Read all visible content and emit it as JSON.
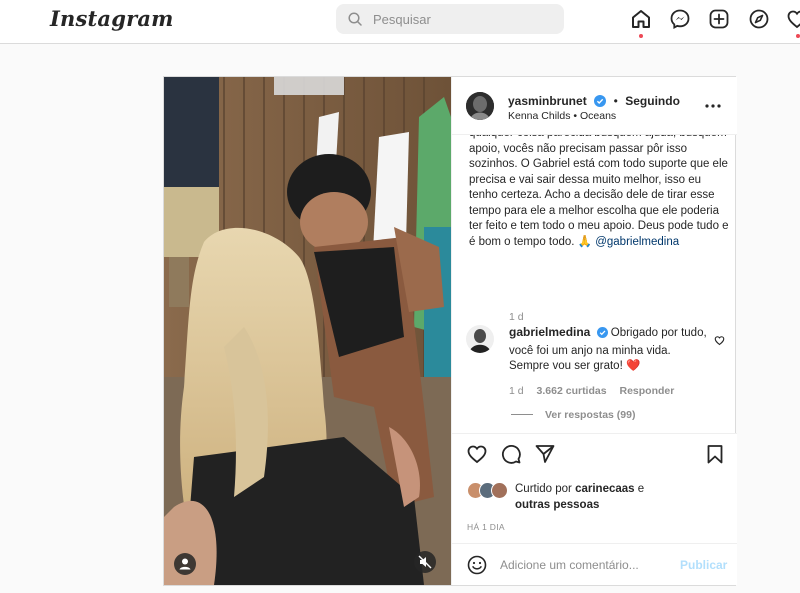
{
  "nav": {
    "logo": "Instagram",
    "search_placeholder": "Pesquisar"
  },
  "post": {
    "author": "yasminbrunet",
    "separator": "•",
    "follow_status": "Seguindo",
    "audio": "Kenna Childs • Oceans",
    "caption": "qualquer coisa parecida busquem ajuda, busquem apoio, vocês não precisam passar pôr isso sozinhos. O Gabriel está com todo suporte que ele precisa e vai sair dessa muito melhor, isso eu tenho certeza. Acho a decisão dele de tirar esse tempo para ele a melhor escolha que ele poderia ter feito e tem todo o meu apoio. Deus pode tudo e é bom o tempo todo.",
    "caption_emoji": "🙏",
    "caption_mention": "@gabrielmedina",
    "caption_time": "1 d",
    "comment": {
      "author": "gabrielmedina",
      "text": "Obrigado por tudo, você foi um anjo na minha vida. Sempre vou ser grato!",
      "emoji": "❤️",
      "time": "1 d",
      "likes": "3.662 curtidas",
      "reply": "Responder",
      "view_replies": "Ver respostas (99)"
    },
    "liked_by_prefix": "Curtido por",
    "liked_by_user": "carinecaas",
    "liked_by_and": "e",
    "liked_by_others": "outras pessoas",
    "timestamp": "HÁ 1 DIA",
    "comment_placeholder": "Adicione um comentário...",
    "publish": "Publicar"
  },
  "colors": {
    "accent": "#0095f6",
    "publish_disabled": "#b2dffc",
    "heart": "#ed4956",
    "verified": "#3897f0",
    "border": "#dbdbdb"
  }
}
